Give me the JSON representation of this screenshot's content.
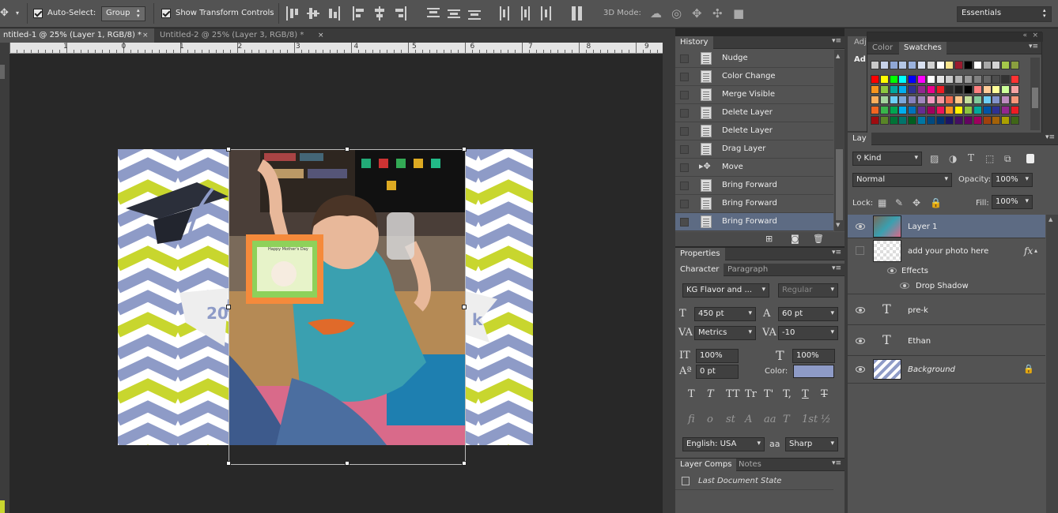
{
  "options_bar": {
    "auto_select_label": "Auto-Select:",
    "auto_select_value": "Group",
    "show_transform_label": "Show Transform Controls",
    "mode_3d_label": "3D Mode:",
    "workspace": "Essentials"
  },
  "doc_tabs": [
    {
      "label": "ntitled-1 @ 25% (Layer 1, RGB/8) *",
      "close": "×"
    },
    {
      "label": "Untitled-2 @ 25% (Layer 3, RGB/8) *",
      "close": "×"
    }
  ],
  "ruler_labels": [
    "1",
    "0",
    "1",
    "2",
    "3",
    "4",
    "5",
    "6",
    "7",
    "8",
    "9"
  ],
  "artwork": {
    "badge_left": "20",
    "badge_right": "k",
    "photo_card_text": "Happy Mother's Day"
  },
  "history": {
    "title": "History",
    "items": [
      "Nudge",
      "Color Change",
      "Merge Visible",
      "Delete Layer",
      "Delete Layer",
      "Drag Layer",
      "Move",
      "Bring Forward",
      "Bring Forward",
      "Bring Forward"
    ]
  },
  "properties": {
    "title": "Properties"
  },
  "character": {
    "tabs": [
      "Character",
      "Paragraph"
    ],
    "font_family": "KG Flavor and ...",
    "font_style": "Regular",
    "font_size": "450 pt",
    "leading": "60 pt",
    "kerning": "Metrics",
    "tracking": "-10",
    "vscale": "100%",
    "hscale": "100%",
    "baseline": "0 pt",
    "color_label": "Color:",
    "color_value": "#8e9bc7",
    "language": "English: USA",
    "aa_label": "a",
    "antialias": "Sharp",
    "style_buttons": [
      "T",
      "T",
      "TT",
      "Tr",
      "T'",
      "T,",
      "T",
      "T"
    ],
    "ot_buttons": [
      "fi",
      "o",
      "st",
      "A",
      "aa",
      "T",
      "1st",
      "½"
    ]
  },
  "layer_comps": {
    "tabs": [
      "Layer Comps",
      "Notes"
    ],
    "item": "Last Document State"
  },
  "color_panel": {
    "tabs": [
      "Color",
      "Swatches"
    ],
    "adjust_label": "Ad"
  },
  "layers": {
    "tab_label": "Lay",
    "filter_label": "Kind",
    "blend_mode": "Normal",
    "opacity_label": "Opacity:",
    "opacity": "100%",
    "lock_label": "Lock:",
    "fill_label": "Fill:",
    "fill": "100%",
    "items": [
      {
        "name": "Layer 1"
      },
      {
        "name": "add your photo here",
        "fx": "fx"
      },
      {
        "name": "Effects"
      },
      {
        "name": "Drop Shadow"
      },
      {
        "name": "pre-k"
      },
      {
        "name": "Ethan"
      },
      {
        "name": "Background"
      }
    ]
  },
  "colors": {
    "accent_selected": "#5d6b83",
    "chevron_blue": "#8e9bc7",
    "chevron_green": "#c8d62e"
  }
}
